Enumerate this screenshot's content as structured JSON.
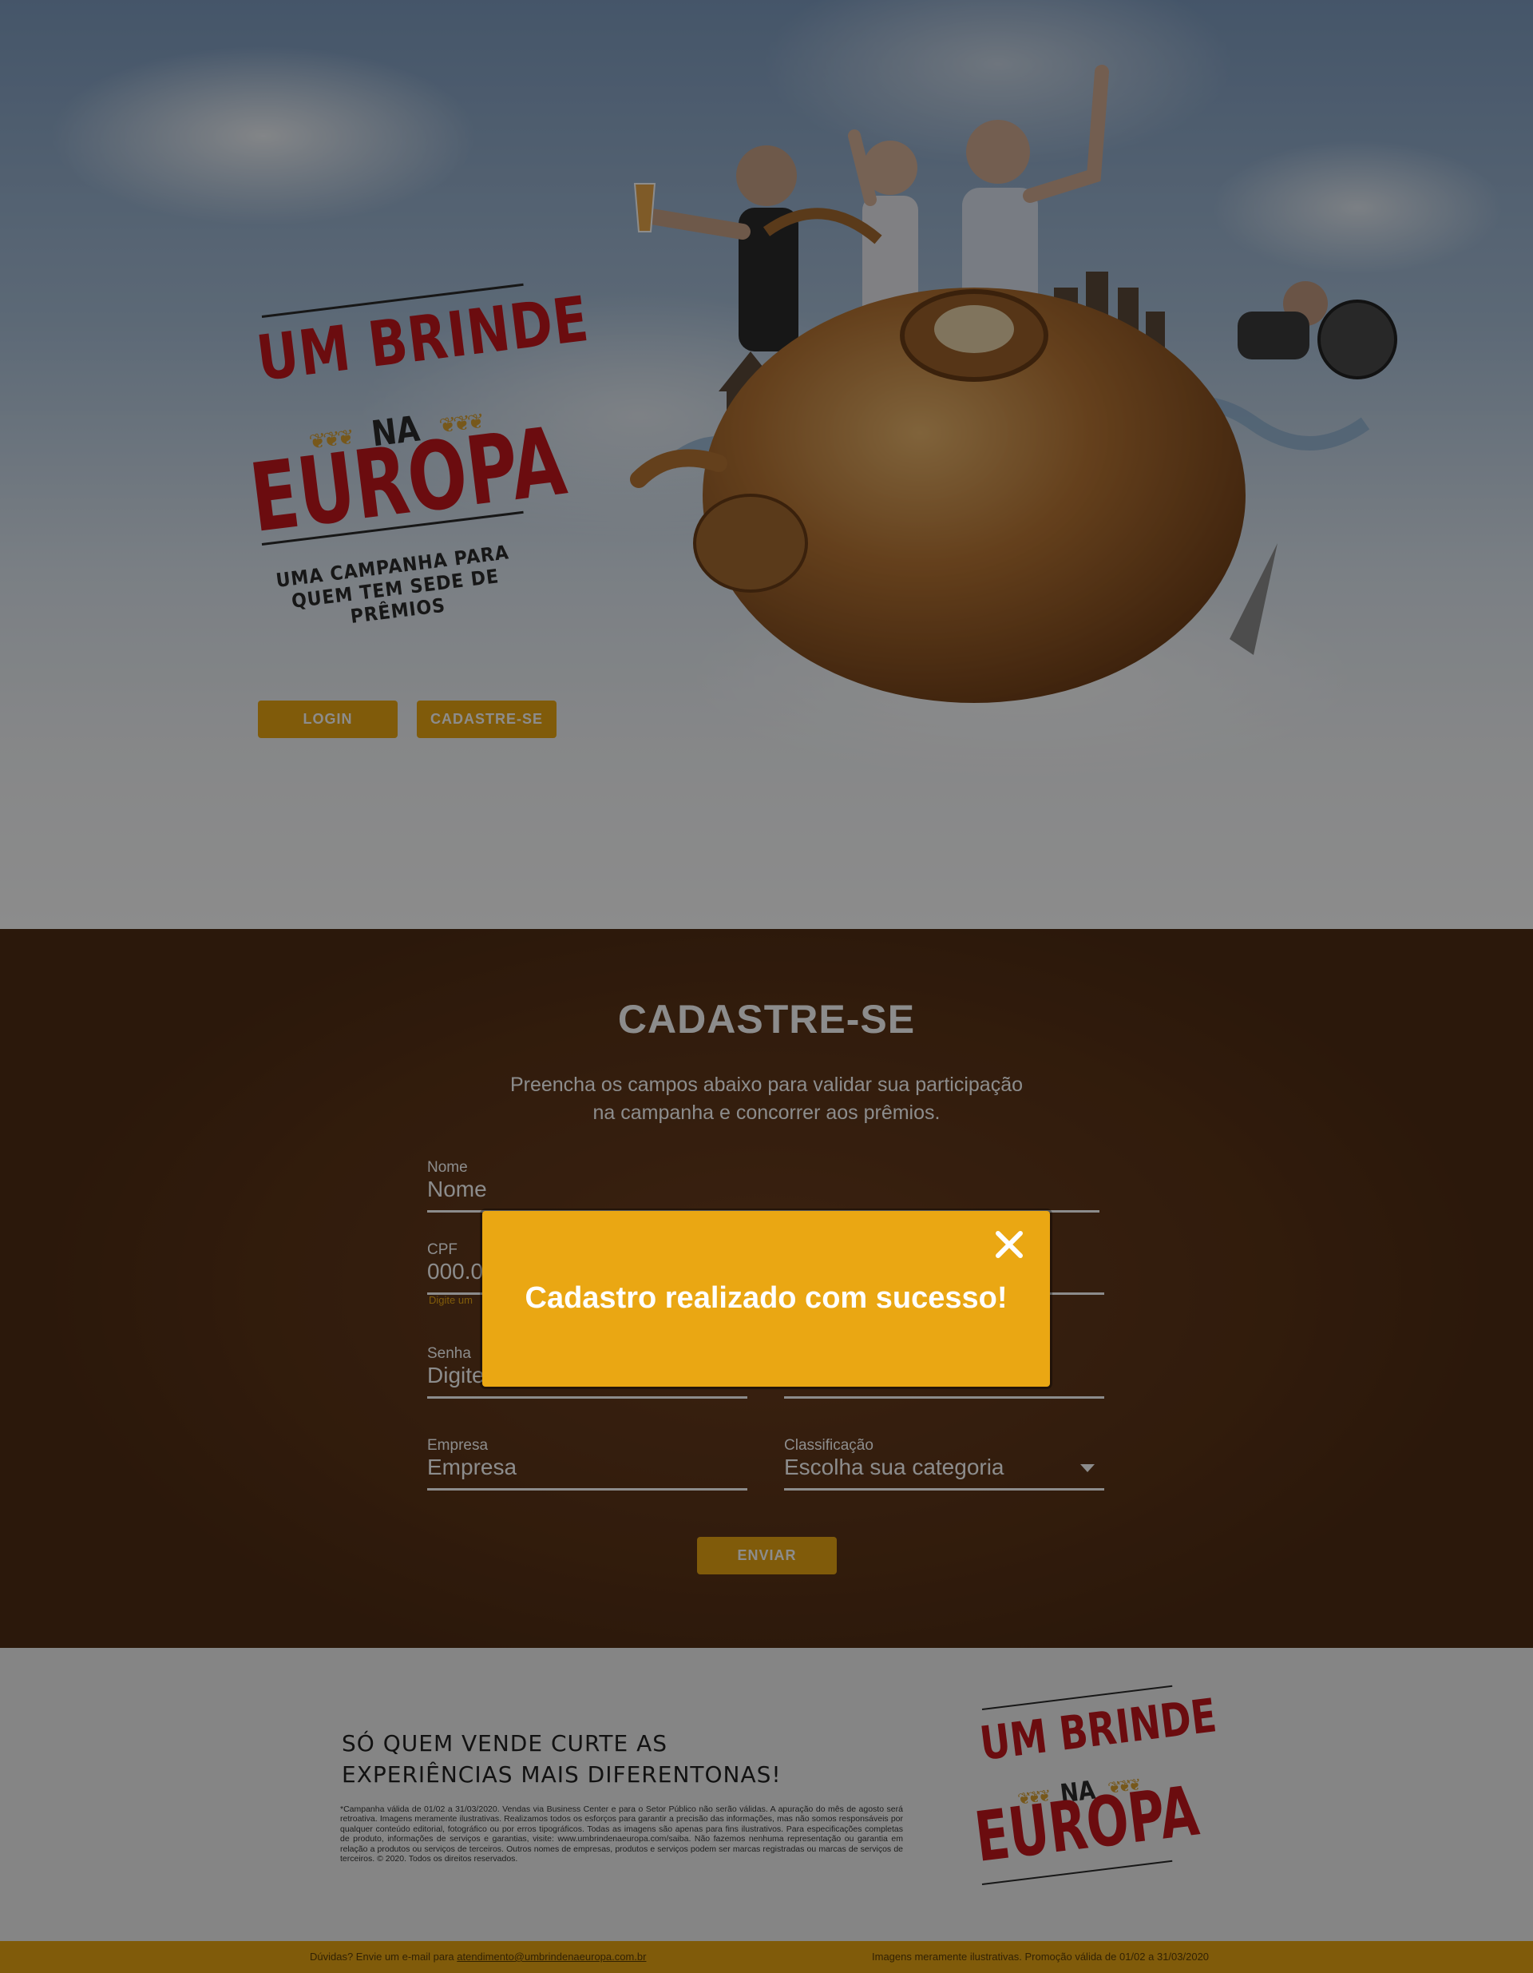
{
  "hero": {
    "logo": {
      "line1": "UM BRINDE",
      "line2": "NA",
      "line3": "EUROPA",
      "tagline_1": "UMA CAMPANHA PARA",
      "tagline_2": "QUEM TEM SEDE DE PRÊMIOS"
    },
    "buttons": {
      "login": "LOGIN",
      "register": "CADASTRE-SE"
    }
  },
  "register": {
    "title": "CADASTRE-SE",
    "subtitle_1": "Preencha os campos abaixo para validar sua participação",
    "subtitle_2": "na campanha e concorrer aos prêmios.",
    "fields": {
      "nome": {
        "label": "Nome",
        "placeholder": "Nome"
      },
      "cpf": {
        "label": "CPF",
        "placeholder": "000.0",
        "hint": "Digite um"
      },
      "senha": {
        "label": "Senha",
        "placeholder": "Digite"
      },
      "empresa": {
        "label": "Empresa",
        "placeholder": "Empresa"
      },
      "classificacao": {
        "label": "Classificação",
        "placeholder": "Escolha sua categoria"
      }
    },
    "submit": "ENVIAR"
  },
  "footer": {
    "headline_1": "SÓ QUEM VENDE CURTE AS",
    "headline_2": "EXPERIÊNCIAS MAIS DIFERENTONAS!",
    "legal": "*Campanha válida de 01/02 a 31/03/2020. Vendas via Business Center e para o Setor Público não serão válidas. A apuração do mês de agosto será retroativa. Imagens meramente ilustrativas. Realizamos todos os esforços para garantir a precisão das informações, mas não somos responsáveis por qualquer conteúdo editorial, fotográfico ou por erros tipográficos. Todas as imagens são apenas para fins ilustrativos. Para especificações completas de produto, informações de serviços e garantias, visite: www.umbrindenaeuropa.com/saiba. Não fazemos nenhuma representação ou garantia em relação a produtos ou serviços de terceiros. Outros nomes de empresas, produtos e serviços podem ser marcas registradas ou marcas de serviços de terceiros. © 2020. Todos os direitos reservados.",
    "logo": {
      "line1": "UM BRINDE",
      "line2": "NA",
      "line3": "EUROPA"
    },
    "bar_left_text": "Dúvidas? Envie um e-mail para ",
    "bar_email": "atendimento@umbrindenaeuropa.com.br",
    "bar_right_text": "Imagens meramente ilustrativas. Promoção válida de 01/02 a 31/03/2020"
  },
  "modal": {
    "message": "Cadastro realizado com sucesso!",
    "close_icon": "close-icon"
  },
  "colors": {
    "accent": "#eaa713",
    "brand_red": "#c4171d",
    "brown": "#5a3317"
  }
}
